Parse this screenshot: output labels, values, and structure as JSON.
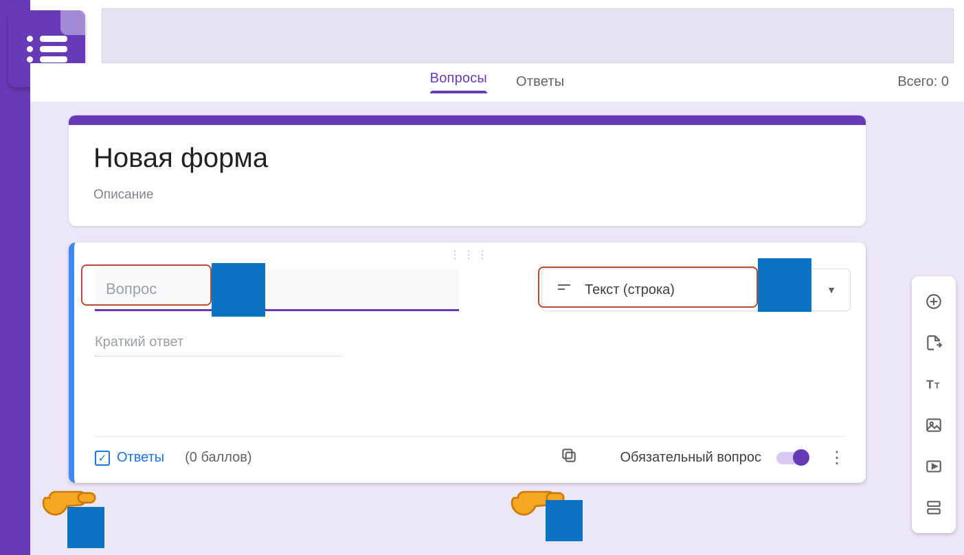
{
  "tabs": {
    "questions": "Вопросы",
    "answers": "Ответы"
  },
  "total_label": "Всего: 0",
  "form": {
    "title": "Новая форма",
    "description": "Описание"
  },
  "question": {
    "placeholder": "Вопрос",
    "type_label": "Текст (строка)",
    "short_answer_hint": "Краткий ответ",
    "answers_label": "Ответы",
    "points_label": "(0 баллов)",
    "required_label": "Обязательный вопрос"
  },
  "toolbar": {
    "add": "add-question",
    "import": "import-questions",
    "title": "add-title",
    "image": "add-image",
    "video": "add-video",
    "section": "add-section"
  }
}
